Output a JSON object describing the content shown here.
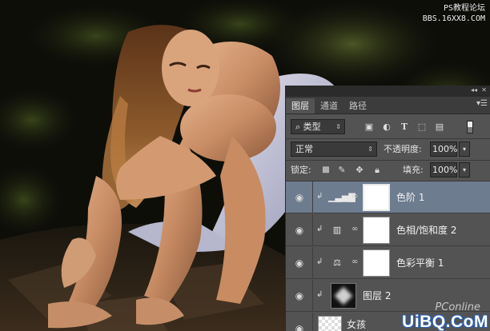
{
  "watermark_top": {
    "line1": "PS教程论坛",
    "line2": "BBS.16XX8.COM"
  },
  "watermark_bottom": {
    "pconline": "PConline",
    "site": "UiBQ.CoM"
  },
  "panel": {
    "tabs": [
      {
        "label": "图层",
        "active": true
      },
      {
        "label": "通道",
        "active": false
      },
      {
        "label": "路径",
        "active": false
      }
    ],
    "filter": {
      "label": "类型",
      "icon": "search-icon"
    },
    "blend_mode": "正常",
    "opacity": {
      "label": "不透明度:",
      "value": "100%"
    },
    "lock": {
      "label": "锁定:"
    },
    "fill": {
      "label": "填充:",
      "value": "100%"
    },
    "layers": [
      {
        "name": "色阶 1",
        "icon": "levels-icon",
        "selected": true,
        "clipped": true
      },
      {
        "name": "色相/饱和度 2",
        "icon": "hue-saturation-icon",
        "selected": false,
        "clipped": true
      },
      {
        "name": "色彩平衡 1",
        "icon": "color-balance-icon",
        "selected": false,
        "clipped": true
      },
      {
        "name": "图层 2",
        "icon": "",
        "selected": false,
        "clipped": true
      },
      {
        "name": "女孩",
        "icon": "",
        "selected": false,
        "clipped": false
      }
    ]
  },
  "colors": {
    "panel_bg": "#535353",
    "selected_row": "#6d7c8f",
    "tab_bar": "#3c3c3c"
  }
}
